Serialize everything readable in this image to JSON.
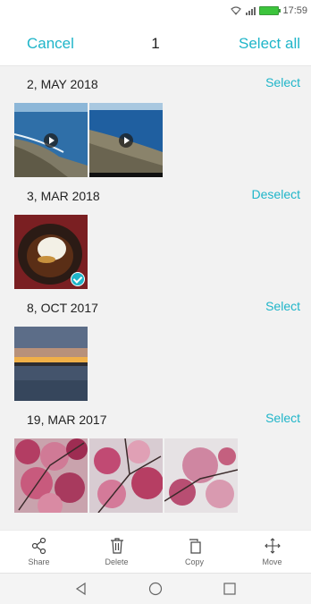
{
  "status_bar": {
    "time": "17:59",
    "icons": [
      "wifi-icon",
      "signal-icon",
      "battery-icon"
    ]
  },
  "topbar": {
    "cancel_label": "Cancel",
    "selected_count": "1",
    "select_all_label": "Select all"
  },
  "colors": {
    "accent": "#1fb5c9",
    "text": "#222222",
    "background": "#f2f2f2"
  },
  "groups": [
    {
      "date": "2, MAY 2018",
      "action": "Select",
      "items": [
        {
          "kind": "video",
          "scene": "coast",
          "selected": false
        },
        {
          "kind": "video",
          "scene": "coast",
          "selected": false
        }
      ]
    },
    {
      "date": "3, MAR 2018",
      "action": "Deselect",
      "items": [
        {
          "kind": "photo",
          "scene": "dessert",
          "selected": true
        }
      ]
    },
    {
      "date": "8, OCT 2017",
      "action": "Select",
      "items": [
        {
          "kind": "photo",
          "scene": "sunset",
          "selected": false
        }
      ]
    },
    {
      "date": "19, MAR 2017",
      "action": "Select",
      "items": [
        {
          "kind": "photo",
          "scene": "blossom",
          "selected": false
        },
        {
          "kind": "photo",
          "scene": "blossom",
          "selected": false
        },
        {
          "kind": "photo",
          "scene": "blossom",
          "selected": false
        }
      ]
    }
  ],
  "bottom_actions": [
    {
      "label": "Share",
      "icon": "share-icon"
    },
    {
      "label": "Delete",
      "icon": "trash-icon"
    },
    {
      "label": "Copy",
      "icon": "copy-icon"
    },
    {
      "label": "Move",
      "icon": "move-icon"
    }
  ],
  "nav": [
    "back-icon",
    "home-icon",
    "recents-icon"
  ]
}
